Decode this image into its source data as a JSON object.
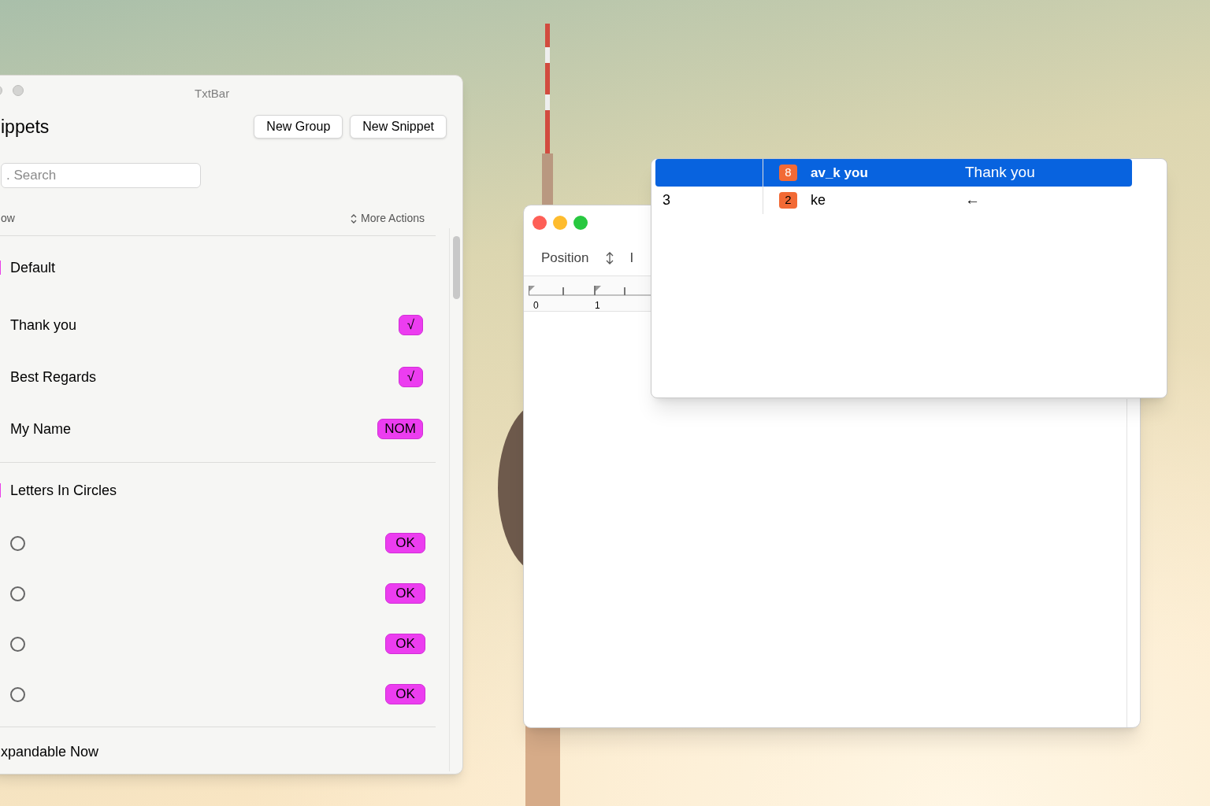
{
  "snippets_window": {
    "title": "TxtBar",
    "heading": "ippets",
    "buttons": [
      "New Group",
      "New Snippet"
    ],
    "search": {
      "placeholder": ". Search"
    },
    "filter_label": "ow",
    "more_actions": "More Actions",
    "groups": [
      {
        "name": "Default",
        "snippets": [
          {
            "kind": "text",
            "label": "Thank you",
            "badge": "√"
          },
          {
            "kind": "text",
            "label": "Best Regards",
            "badge": "√"
          },
          {
            "kind": "text",
            "label": "My Name",
            "badge": "NOM"
          }
        ]
      },
      {
        "name": "Letters In Circles",
        "snippets": [
          {
            "kind": "circle",
            "badge": "OK"
          },
          {
            "kind": "circle",
            "badge": "OK"
          },
          {
            "kind": "circle",
            "badge": "OK"
          },
          {
            "kind": "circle",
            "badge": "OK"
          }
        ]
      },
      {
        "name": "xpandable Now"
      }
    ]
  },
  "editor_window": {
    "toolbar_label": "Position",
    "toolbar_cut": "I",
    "ruler_labels": [
      "0",
      "1"
    ]
  },
  "suggestion_popup": {
    "rows": [
      {
        "selected": true,
        "number": "8",
        "abbreviation": "av_k you",
        "expansion": "Thank you"
      },
      {
        "selected": false,
        "column_1": "3",
        "number": "2",
        "abbreviation": "ke",
        "expansion": "←"
      }
    ]
  }
}
